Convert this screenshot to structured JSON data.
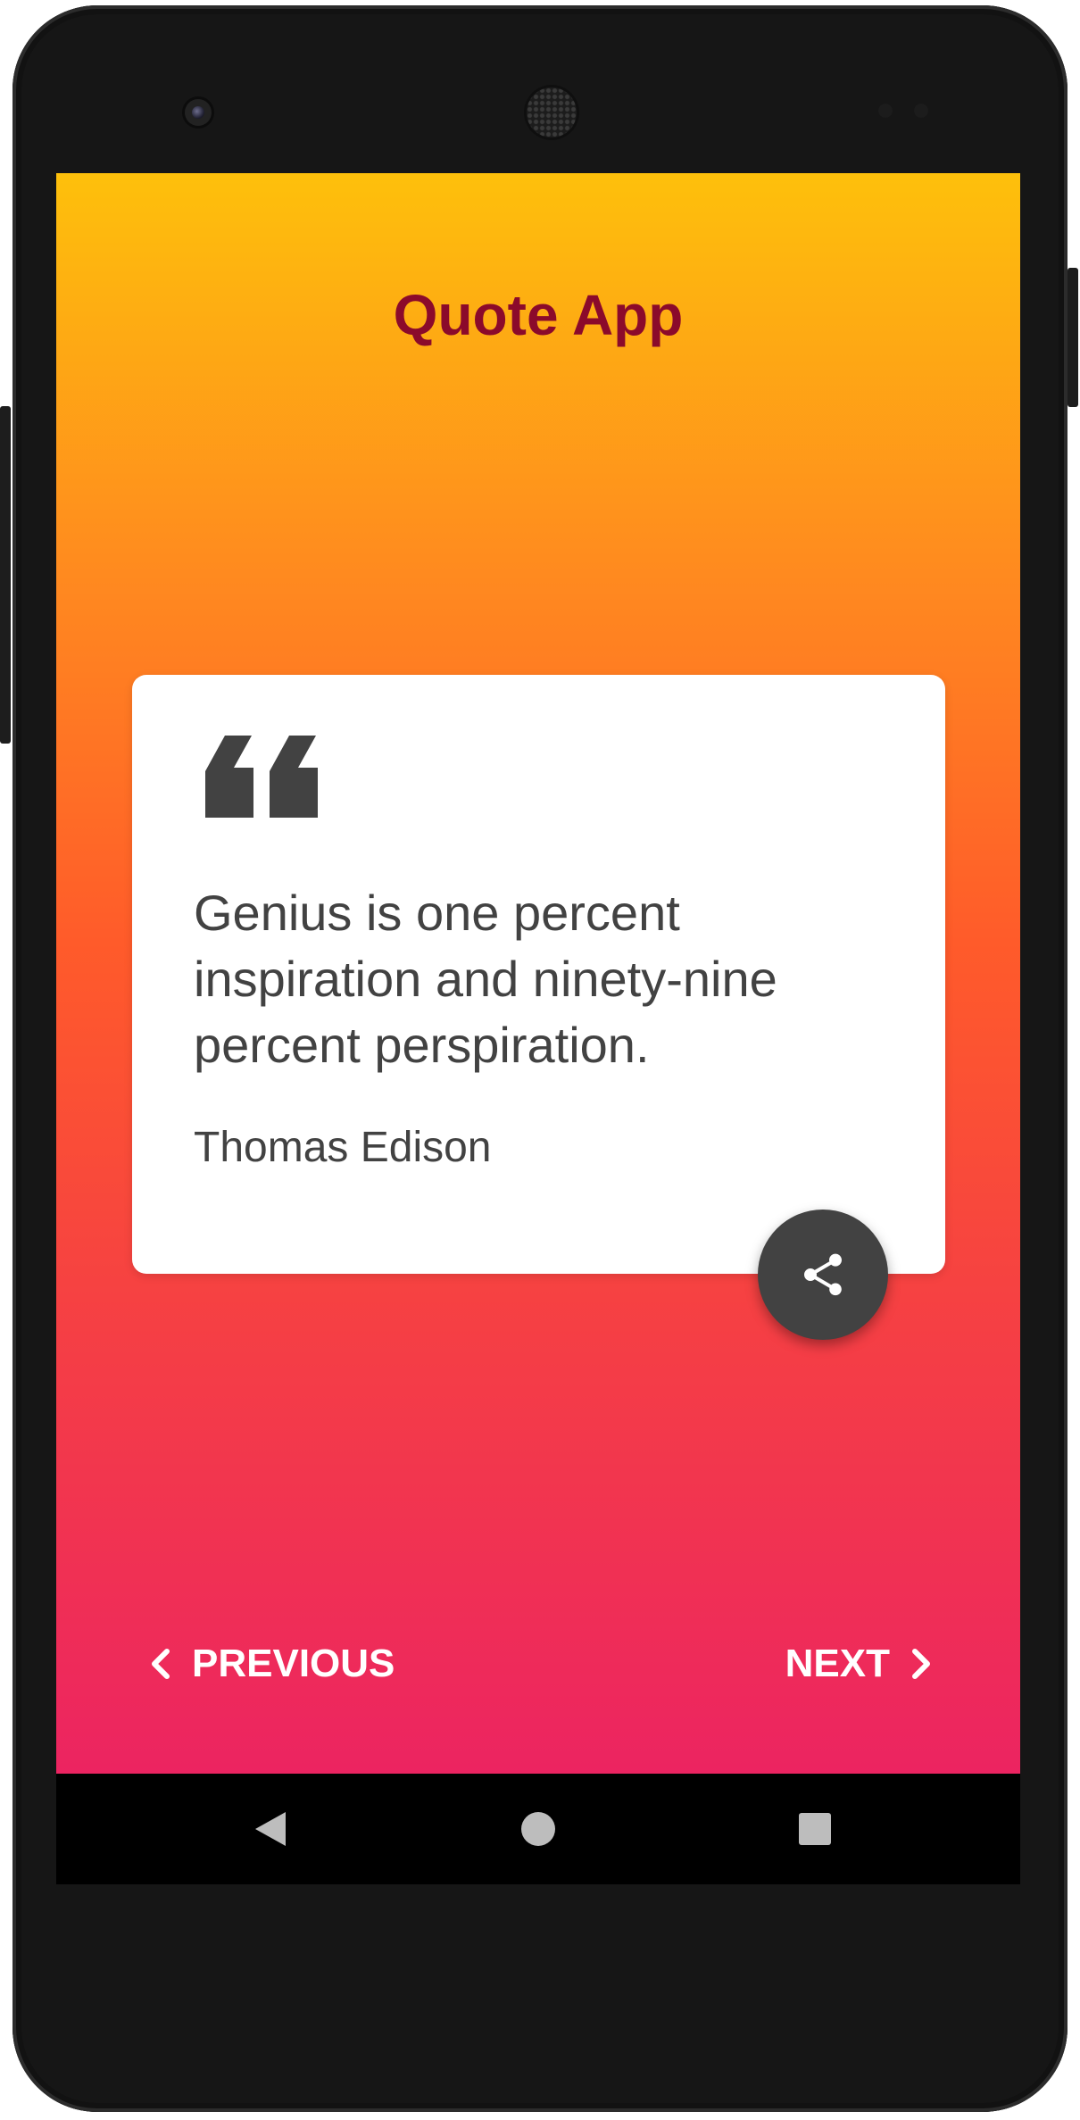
{
  "app": {
    "title": "Quote App"
  },
  "quote": {
    "text": "Genius is one percent inspiration and ninety-nine percent perspiration.",
    "author": "Thomas Edison",
    "icon": "quote-open-icon"
  },
  "actions": {
    "share_icon": "share-icon",
    "previous_label": "PREVIOUS",
    "next_label": "NEXT"
  },
  "system_nav": {
    "back_icon": "back-triangle-icon",
    "home_icon": "home-circle-icon",
    "recents_icon": "recents-square-icon"
  },
  "colors": {
    "title": "#8b0a2b",
    "gradient_top": "#fec00b",
    "gradient_mid": "#ff5b2a",
    "gradient_bottom": "#ec2461",
    "card": "#ffffff",
    "text": "#424242",
    "share_button": "#424242"
  }
}
